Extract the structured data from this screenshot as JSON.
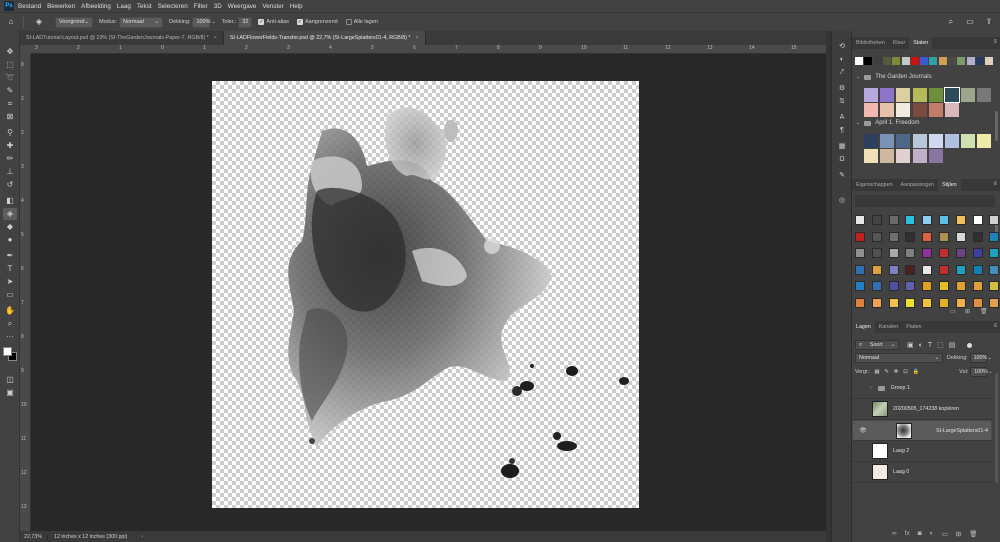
{
  "menu": [
    "Bestand",
    "Bewerken",
    "Afbeelding",
    "Laag",
    "Tekst",
    "Selecteren",
    "Filter",
    "3D",
    "Weergave",
    "Venster",
    "Help"
  ],
  "options": {
    "fill_source": "Voorgrond",
    "mode_label": "Modus:",
    "mode_value": "Normaal",
    "opacity_label": "Dekking:",
    "opacity_value": "100%",
    "tolerance_label": "Toler.:",
    "tolerance_value": "32",
    "anti_alias": "Anti-alias",
    "contiguous": "Aangrenzend",
    "all_layers": "Alle lagen"
  },
  "tabs": [
    {
      "label": "SI-LADTutorial-Layout.psd @ 23% (SI-TheGardenJournals-Paper-7, RGB/8) *",
      "active": false
    },
    {
      "label": "SI-LADFlowerFields-Transfer.psd @ 22,7% (SI-LargeSplatters01-4, RGB/8) *",
      "active": true
    }
  ],
  "ruler_h": [
    "3",
    "2",
    "1",
    "0",
    "1",
    "2",
    "3",
    "4",
    "5",
    "6",
    "7",
    "8",
    "9",
    "10",
    "11",
    "12",
    "13",
    "14",
    "15"
  ],
  "ruler_v": [
    "8",
    "2",
    "2",
    "3",
    "4",
    "5",
    "6",
    "7",
    "8",
    "9",
    "10",
    "11",
    "12",
    "13"
  ],
  "status": {
    "zoom": "22,73%",
    "doc": "12 inches x 12 inches (300 ppi)"
  },
  "swatches_panel": {
    "tabs": [
      "Bibliotheken",
      "Kleur",
      "Stalen"
    ],
    "top_row": [
      "#ffffff",
      "#000000",
      "#3e3e3e",
      "#545c3d",
      "#7b8a3a",
      "#c0c8c8",
      "#d01010",
      "#3a5ad0",
      "#2ea2a2",
      "#d0a050",
      "#4a4a4a",
      "#7a9a6a",
      "#b0b0d0",
      "#2a3a5a",
      "#e0d0c0"
    ],
    "groups": [
      {
        "name": "The Garden Journals",
        "colors": [
          "#b8a8e0",
          "#8e74c8",
          "#ddd0a0",
          "#b6ba5a",
          "#6e8f3a",
          "#2b4b58",
          "#9ea68e",
          "#787878",
          "#f0b8b0",
          "#e6c0a8",
          "#f0eadf",
          "#7b4a3e",
          "#c47c6a",
          "#d8b8b8"
        ]
      },
      {
        "name": "April 1. Freedom",
        "colors": [
          "#2e3e5e",
          "#7a92b8",
          "#4e6688",
          "#b8c8d8",
          "#cfd8ee",
          "#b0c0e0",
          "#d0e0b0",
          "#eeeaa8",
          "#f0e0b8",
          "#d0b8a0",
          "#e0d0d0",
          "#c0b0c8",
          "#8a74a0"
        ]
      }
    ]
  },
  "styles_panel": {
    "tabs": [
      "Eigenschappen",
      "Aanpassingen",
      "Stijlen"
    ]
  },
  "layers_panel": {
    "tabs": [
      "Lagen",
      "Kanalen",
      "Paden"
    ],
    "filter": "Soort",
    "blend": "Normaal",
    "opacity_label": "Dekking:",
    "opacity_value": "100%",
    "lock_label": "Vergr.:",
    "fill_label": "Vul:",
    "fill_value": "100%",
    "layers": [
      {
        "name": "Groep 1",
        "type": "group",
        "visible": false,
        "selected": false
      },
      {
        "name": "20200505_174238 kopiëren",
        "type": "photo",
        "visible": false,
        "selected": false
      },
      {
        "name": "SI-LargeSplatters01-4",
        "type": "smart",
        "visible": true,
        "selected": true
      },
      {
        "name": "Laag 2",
        "type": "white",
        "visible": false,
        "selected": false
      },
      {
        "name": "Laag 0",
        "type": "paper",
        "visible": false,
        "selected": false
      }
    ]
  }
}
